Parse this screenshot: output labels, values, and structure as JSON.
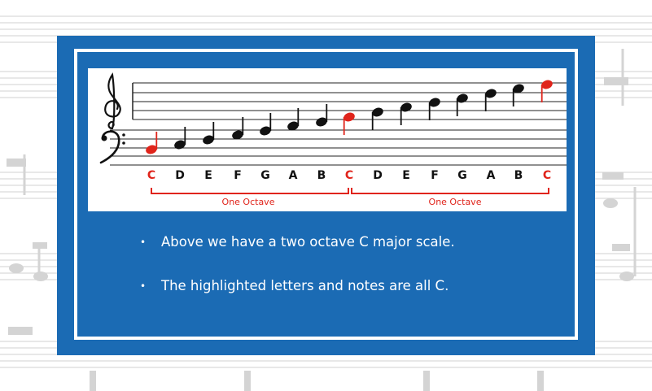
{
  "colors": {
    "frame_blue": "#1b6bb4",
    "highlight_red": "#e0241b",
    "note_black": "#111111"
  },
  "score": {
    "treble_clef_icon": "treble-clef",
    "bass_clef_icon": "bass-clef",
    "letters": [
      {
        "text": "C",
        "highlight": true
      },
      {
        "text": "D",
        "highlight": false
      },
      {
        "text": "E",
        "highlight": false
      },
      {
        "text": "F",
        "highlight": false
      },
      {
        "text": "G",
        "highlight": false
      },
      {
        "text": "A",
        "highlight": false
      },
      {
        "text": "B",
        "highlight": false
      },
      {
        "text": "C",
        "highlight": true
      },
      {
        "text": "D",
        "highlight": false
      },
      {
        "text": "E",
        "highlight": false
      },
      {
        "text": "F",
        "highlight": false
      },
      {
        "text": "G",
        "highlight": false
      },
      {
        "text": "A",
        "highlight": false
      },
      {
        "text": "B",
        "highlight": false
      },
      {
        "text": "C",
        "highlight": true
      }
    ],
    "octave_labels": [
      "One Octave",
      "One Octave"
    ]
  },
  "bullets": [
    "Above we have a two octave C major scale.",
    "The highlighted letters and notes are all C."
  ]
}
